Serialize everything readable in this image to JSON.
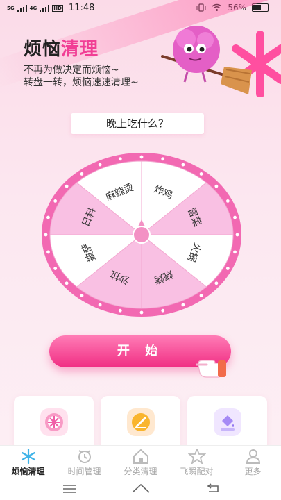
{
  "status": {
    "net1": "5G",
    "net2": "4G",
    "hd": "HD",
    "time": "11:48",
    "battery": "56%"
  },
  "header": {
    "title_part1": "烦恼",
    "title_part2": "清理",
    "subtitle_line1": "不再为做决定而烦恼~",
    "subtitle_line2": "转盘一转，烦恼速速清理~"
  },
  "question": "晚上吃什么？",
  "wheel": {
    "segments": [
      {
        "label": "炸鸡",
        "color": "#ffffff"
      },
      {
        "label": "冒菜",
        "color": "#f9c0e3"
      },
      {
        "label": "火锅",
        "color": "#ffffff"
      },
      {
        "label": "烧烤",
        "color": "#f9c0e3"
      },
      {
        "label": "沙拉",
        "color": "#f9c0e3"
      },
      {
        "label": "披萨",
        "color": "#ffffff"
      },
      {
        "label": "日料",
        "color": "#f9c0e3"
      },
      {
        "label": "麻辣烫",
        "color": "#ffffff"
      }
    ],
    "rim_color": "#f269b2",
    "pointer_color": "#f391c4"
  },
  "start_button": "开 始",
  "cards": [
    {
      "icon": "wheel-icon",
      "color": "#ffe1ee"
    },
    {
      "icon": "pen-icon",
      "color": "#ffe8cf"
    },
    {
      "icon": "paint-bucket-icon",
      "color": "#f0e6ff"
    }
  ],
  "tabs": [
    {
      "label": "烦恼清理",
      "icon": "snowflake-icon",
      "active": true
    },
    {
      "label": "时间管理",
      "icon": "alarm-clock-icon",
      "active": false
    },
    {
      "label": "分类清理",
      "icon": "home-icon",
      "active": false
    },
    {
      "label": "飞瞬配对",
      "icon": "star-icon",
      "active": false
    },
    {
      "label": "更多",
      "icon": "person-icon",
      "active": false
    }
  ],
  "colors": {
    "accent": "#f13e95",
    "button_top": "#ff7cb6",
    "button_bottom": "#f02e83"
  }
}
